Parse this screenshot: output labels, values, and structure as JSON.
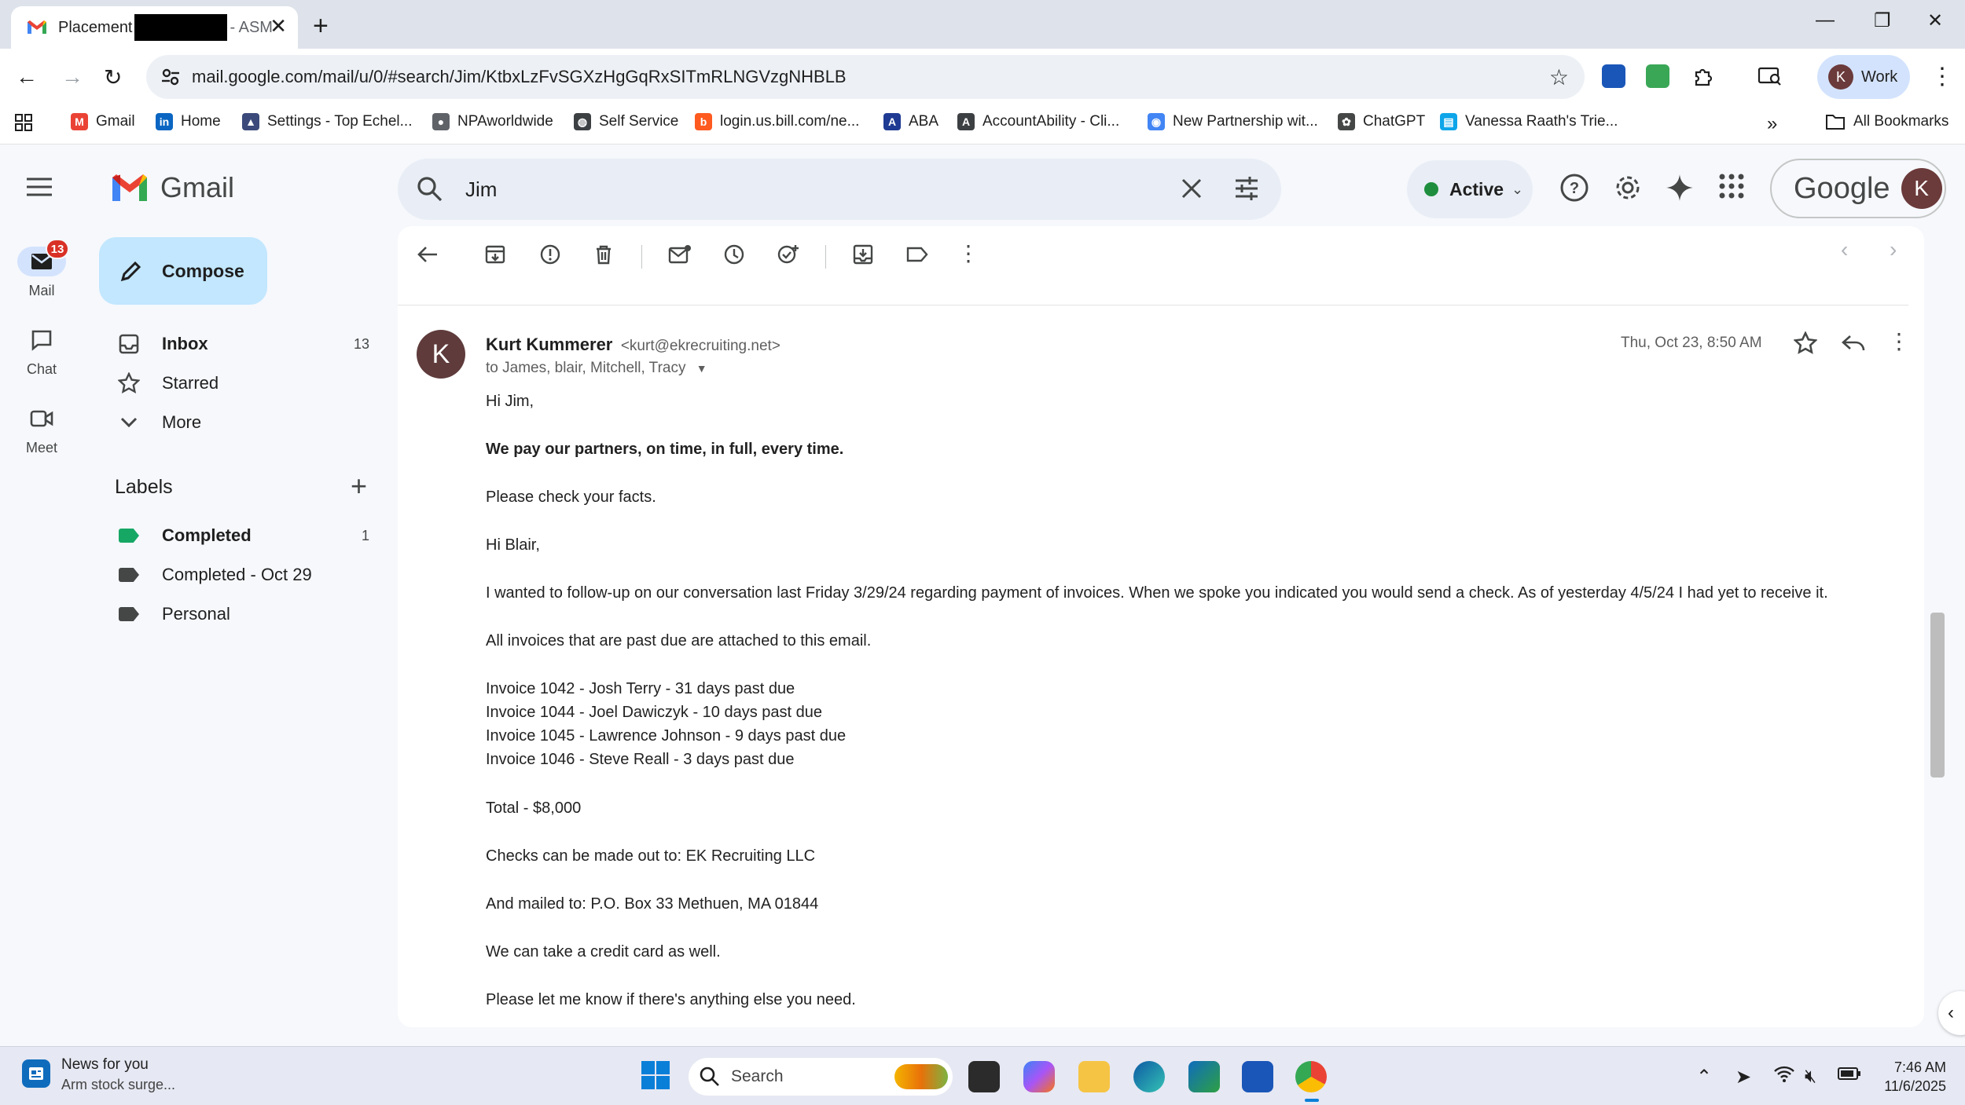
{
  "browser": {
    "tab": {
      "title_start": "Placement",
      "title_end": "- ASM"
    },
    "url": "mail.google.com/mail/u/0/#search/Jim/KtbxLzFvSGXzHgGqRxSITmRLNGVzgNHBLB",
    "profile_label": "Work",
    "profile_initial": "K",
    "bookmarks": [
      {
        "label": "Gmail",
        "icon": "gmail-icon",
        "color": "#ea4335"
      },
      {
        "label": "Home",
        "icon": "linkedin-icon",
        "color": "#0a66c2"
      },
      {
        "label": "Settings - Top Echel...",
        "icon": "settings-site-icon",
        "color": "#3b4a7a"
      },
      {
        "label": "NPAworldwide",
        "icon": "location-pin-icon",
        "color": "#444746"
      },
      {
        "label": "Self Service",
        "icon": "globe-icon",
        "color": "#444746"
      },
      {
        "label": "login.us.bill.com/ne...",
        "icon": "bill-icon",
        "color": "#ff5a1f"
      },
      {
        "label": "ABA",
        "icon": "aba-icon",
        "color": "#1f3a93"
      },
      {
        "label": "AccountAbility - Cli...",
        "icon": "accountability-icon",
        "color": "#3c4043"
      },
      {
        "label": "New Partnership wit...",
        "icon": "partnership-icon",
        "color": "#4285f4"
      },
      {
        "label": "ChatGPT",
        "icon": "chatgpt-icon",
        "color": "#444746"
      },
      {
        "label": "Vanessa Raath's Trie...",
        "icon": "trello-icon",
        "color": "#0ea5e9"
      }
    ],
    "all_bookmarks": "All Bookmarks"
  },
  "gmail": {
    "app_name": "Gmail",
    "search_query": "Jim",
    "status": "Active",
    "account_brand": "Google",
    "account_initial": "K",
    "rail": [
      {
        "label": "Mail",
        "badge": "13"
      },
      {
        "label": "Chat"
      },
      {
        "label": "Meet"
      }
    ],
    "compose_label": "Compose",
    "nav": [
      {
        "label": "Inbox",
        "count": "13"
      },
      {
        "label": "Starred"
      },
      {
        "label": "More"
      }
    ],
    "labels_title": "Labels",
    "labels": [
      {
        "name": "Completed",
        "count": "1",
        "color": "#16a765"
      },
      {
        "name": "Completed - Oct 29",
        "color": "#444746"
      },
      {
        "name": "Personal",
        "color": "#444746"
      }
    ]
  },
  "message": {
    "sender_initial": "K",
    "sender_name": "Kurt Kummerer",
    "sender_email": "<kurt@ekrecruiting.net>",
    "to": "to James, blair, Mitchell, Tracy",
    "date": "Thu, Oct 23, 8:50 AM",
    "body": [
      "Hi Jim,",
      "We pay our partners, on time, in full, every time.",
      "Please check your facts.",
      "Hi Blair,",
      "I wanted to follow-up on our conversation last Friday 3/29/24 regarding payment of invoices. When we spoke you indicated you would send a check. As of yesterday 4/5/24 I had yet to receive it.",
      "All invoices that are past due are attached to this email.",
      "Invoice 1042 - Josh Terry - 31 days past due",
      "Invoice 1044 - Joel Dawiczyk - 10 days past due",
      "Invoice 1045 - Lawrence Johnson - 9 days past due",
      "Invoice 1046 - Steve Reall - 3 days past due",
      "Total - $8,000",
      "Checks can be made out to: EK Recruiting LLC",
      "And mailed to: P.O. Box 33 Methuen, MA 01844",
      "We can take a credit card as well.",
      "Please let me know if there's anything else you need."
    ]
  },
  "taskbar": {
    "news_title": "News for you",
    "news_sub": "Arm stock surge...",
    "search_label": "Search",
    "time": "7:46 AM",
    "date": "11/6/2025"
  },
  "colors": {
    "compose_bg": "#c2e7ff",
    "badge": "#d93025",
    "active_dot": "#1e8e3e",
    "gmail_red": "#ea4335"
  }
}
